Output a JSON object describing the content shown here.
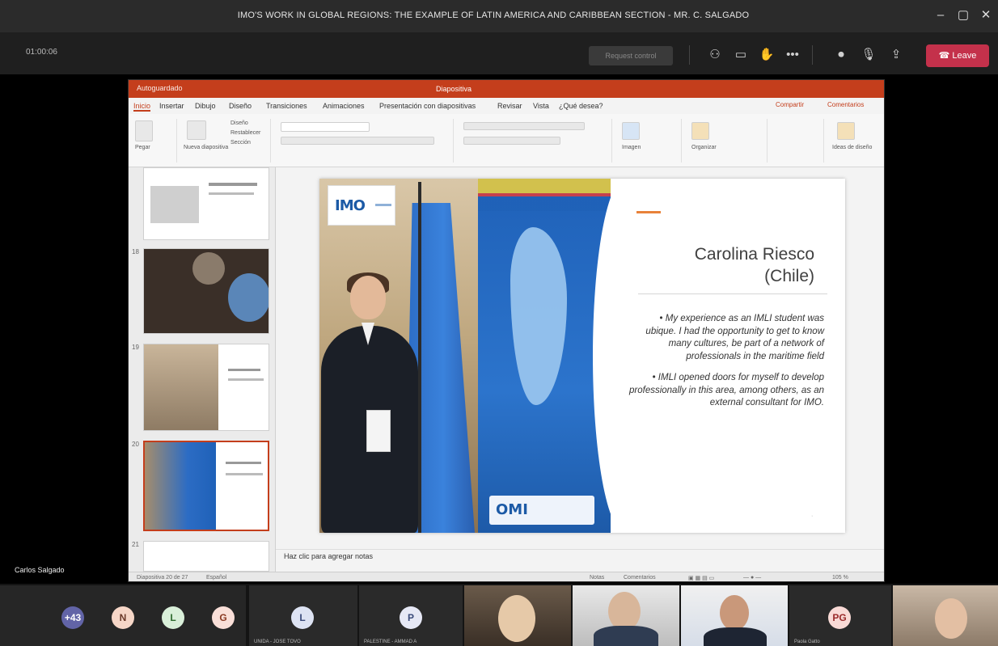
{
  "window": {
    "title": "IMO'S WORK IN GLOBAL REGIONS: THE EXAMPLE OF LATIN AMERICA AND CARIBBEAN SECTION - MR. C. SALGADO"
  },
  "toolbar": {
    "timer": "01:00:06",
    "leave_label": "Leave",
    "pill_label": "Request control"
  },
  "powerpoint": {
    "document_title": "Diapositiva",
    "qat": "Autoguardado",
    "tabs": [
      "Inicio",
      "Insertar",
      "Dibujo",
      "Diseño",
      "Transiciones",
      "Animaciones",
      "Presentación con diapositivas",
      "Revisar",
      "Vista",
      "¿Qué desea?"
    ],
    "share_label": "Compartir",
    "comments_label": "Comentarios",
    "ribbon_labels": {
      "paste": "Pegar",
      "new_slide": "Nueva diapositiva",
      "layout": "Diseño",
      "reset": "Restablecer",
      "section": "Sección",
      "image": "Imagen",
      "organize": "Organizar",
      "designer": "Ideas de diseño"
    },
    "thumb_numbers": [
      "",
      "18",
      "19",
      "20",
      "21"
    ],
    "notes_placeholder": "Haz clic para agregar notas",
    "status_left": "Diapositiva 20 de 27",
    "status_lang": "Español",
    "status_notes": "Notas",
    "status_comments": "Comentarios",
    "status_zoom": "105 %"
  },
  "slide": {
    "logo": "IMO",
    "name": "Carolina Riesco (Chile)",
    "bullets": [
      "My experience as an IMLI student was ubique. I had the opportunity to get to know many cultures, be part of a network of professionals in the maritime field",
      "IMLI opened doors for myself to develop professionally in this area, among others, as an external consultant for IMO."
    ],
    "banner_logo": "OMI"
  },
  "presenter_name": "Carlos Salgado",
  "participants": [
    {
      "initials": "+43",
      "color": "#6264a7",
      "text_color": "#ffffff"
    },
    {
      "initials": "N",
      "color": "#f6d6c7",
      "text_color": "#6b3a2a"
    },
    {
      "initials": "L",
      "color": "#d9efd9",
      "text_color": "#2f6b2f"
    },
    {
      "initials": "G",
      "color": "#f9dfd8",
      "text_color": "#8a3a22"
    },
    {
      "initials": "L",
      "color": "#dde3f3",
      "text_color": "#3a4a7a",
      "name": "UNIDA - JOSE TOVO"
    },
    {
      "initials": "P",
      "color": "#e6e8f5",
      "text_color": "#3a4a7a",
      "name": "PALESTINE - AMMAD A"
    },
    {
      "initials": "PG",
      "color": "#f9dad6",
      "text_color": "#9a2a2a",
      "name": "Paola Gatto"
    }
  ],
  "colors": {
    "leave": "#c4314b",
    "powerpoint_accent": "#c43e1c",
    "imo_blue": "#1c5aa6"
  }
}
